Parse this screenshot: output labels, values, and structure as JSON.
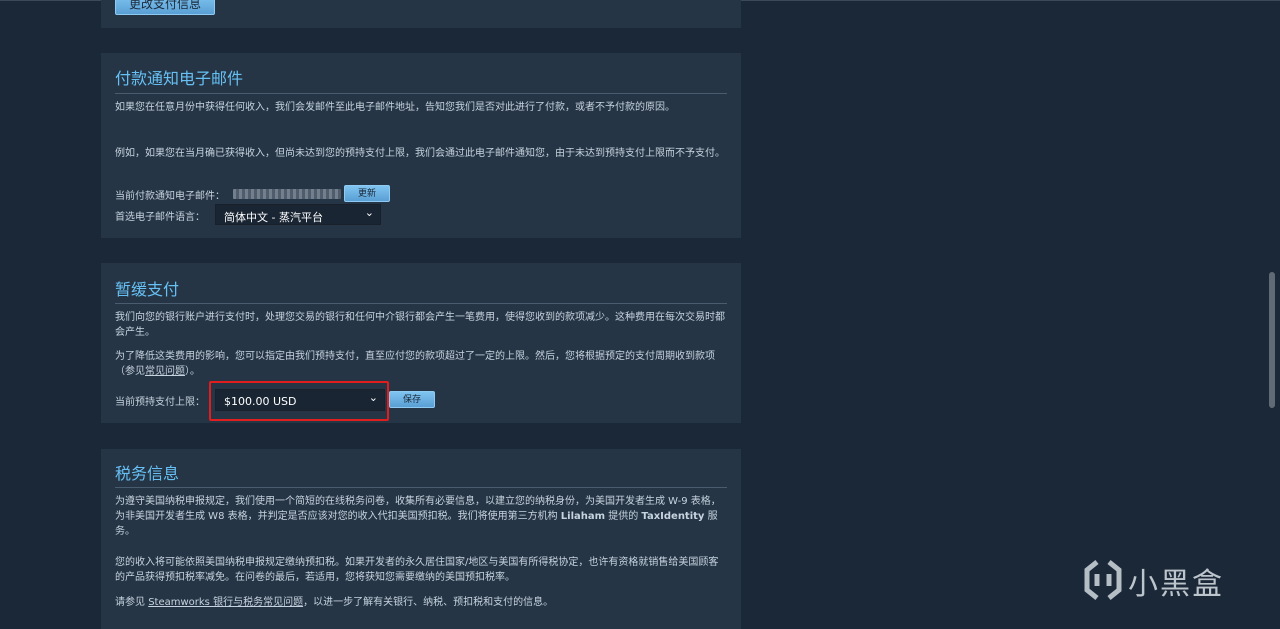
{
  "prev_section": {
    "button_label": "更改支付信息"
  },
  "payment_notify": {
    "title": "付款通知电子邮件",
    "para1": "如果您在任意月份中获得任何收入，我们会发邮件至此电子邮件地址，告知您我们是否对此进行了付款，或者不予付款的原因。",
    "para2": "例如，如果您在当月确已获得收入，但尚未达到您的预持支付上限，我们会通过此电子邮件通知您，由于未达到预持支付上限而不予支付。",
    "current_email_label": "当前付款通知电子邮件：",
    "update_button": "更新",
    "language_label": "首选电子邮件语言：",
    "language_value": "简体中文 - 蒸汽平台"
  },
  "deferred": {
    "title": "暂缓支付",
    "para1": "我们向您的银行账户进行支付时，处理您交易的银行和任何中介银行都会产生一笔费用，使得您收到的款项减少。这种费用在每次交易时都会产生。",
    "para2_a": "为了降低这类费用的影响，您可以指定由我们预持支付，直至应付您的款项超过了一定的上限。然后，您将根据预定的支付周期收到款项（参见",
    "para2_link": "常见问题",
    "para2_b": "）。",
    "threshold_label": "当前预持支付上限：",
    "threshold_value": "$100.00 USD",
    "save_button": "保存",
    "highlight_color": "#e21d1d"
  },
  "tax": {
    "title": "税务信息",
    "para1_a": "为遵守美国纳税申报规定，我们使用一个简短的在线税务问卷，收集所有必要信息，以建立您的纳税身份，为美国开发者生成 W-9 表格，为非美国开发者生成 W8 表格，并判定是否应该对您的收入代扣美国预扣税。我们将使用第三方机构 ",
    "para1_bold1": "Lilaham",
    "para1_b": " 提供的 ",
    "para1_bold2": "TaxIdentity",
    "para1_c": " 服务。",
    "para2": "您的收入将可能依照美国纳税申报规定缴纳预扣税。如果开发者的永久居住国家/地区与美国有所得税协定，也许有资格就销售给美国顾客的产品获得预扣税率减免。在问卷的最后，若适用，您将获知您需要缴纳的美国预扣税率。",
    "para3_a": "请参见 ",
    "para3_link": "Steamworks 银行与税务常见问题",
    "para3_b": "，以进一步了解有关银行、纳税、预扣税和支付的信息。"
  },
  "watermark": {
    "text": "小黑盒"
  },
  "colors": {
    "accent": "#66c0f4",
    "background": "#1b2838",
    "panel": "#263545"
  }
}
